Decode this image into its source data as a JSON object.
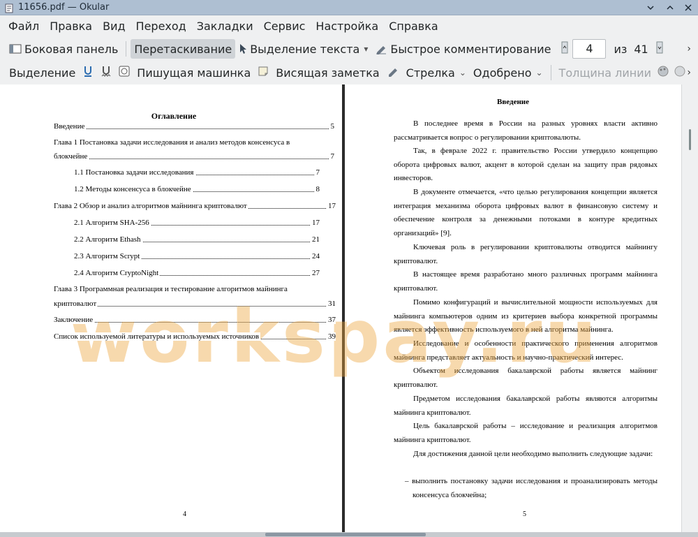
{
  "window": {
    "title": "11656.pdf  — Okular"
  },
  "menubar": [
    "Файл",
    "Правка",
    "Вид",
    "Переход",
    "Закладки",
    "Сервис",
    "Настройка",
    "Справка"
  ],
  "toolbar1": {
    "sidebar": "Боковая панель",
    "drag": "Перетаскивание",
    "select_text": "Выделение текста",
    "quick_comment": "Быстрое комментирование",
    "page_current": "4",
    "page_of": "из",
    "page_total": "41"
  },
  "toolbar2": {
    "selection": "Выделение",
    "typewriter": "Пишущая машинка",
    "sticky_note": "Висящая заметка",
    "arrow": "Стрелка",
    "approved": "Одобрено",
    "line_width": "Толщина линии"
  },
  "left_page": {
    "title": "Оглавление",
    "entries": [
      {
        "text": "Введение",
        "page": "5"
      },
      {
        "text": "Глава 1 Постановка задачи исследования и анализ методов консенсуса в",
        "page": ""
      },
      {
        "text": "блокчейне",
        "page": "7"
      },
      {
        "text": "1.1 Постановка задачи исследования",
        "page": "7"
      },
      {
        "text": "1.2 Методы консенсуса в блокчейне",
        "page": "8"
      },
      {
        "text": "Глава 2 Обзор и анализ алгоритмов майнинга криптовалют",
        "page": "17"
      },
      {
        "text": "2.1 Алгоритм SHA-256",
        "page": "17"
      },
      {
        "text": "2.2 Алгоритм Ethash",
        "page": "21"
      },
      {
        "text": "2.3 Алгоритм Scrypt",
        "page": "24"
      },
      {
        "text": "2.4 Алгоритм CryptoNight",
        "page": "27"
      },
      {
        "text": "Глава 3 Программная реализация и тестирование алгоритмов майнинга",
        "page": ""
      },
      {
        "text": "криптовалют",
        "page": "31"
      },
      {
        "text": "Заключение",
        "page": "37"
      },
      {
        "text": "Список используемой литературы и используемых источников",
        "page": "39"
      }
    ],
    "page_number": "4"
  },
  "right_page": {
    "title": "Введение",
    "paragraphs": [
      "В последнее время в России на разных уровнях власти активно рассматривается вопрос о регулировании криптовалюты.",
      "Так, в феврале 2022 г. правительство России утвердило концепцию оборота цифровых валют, акцент в которой сделан на защиту прав рядовых инвесторов.",
      "В документе отмечается, «что целью регулирования концепции является интеграция механизма оборота цифровых валют в финансовую систему и обеспечение контроля за денежными потоками в контуре кредитных организаций» [9].",
      "Ключевая роль в регулировании криптовалюты отводится майнингу криптовалют.",
      "В настоящее время разработано много различных программ майнинга криптовалют.",
      "Помимо конфигураций и вычислительной мощности используемых для майнинга компьютеров одним из критериев выбора конкретной программы является эффективность используемого в ней алгоритма майнинга.",
      "Исследование и особенности практического применения алгоритмов майнинга представляет актуальность и научно-практический интерес.",
      "Объектом исследования бакалаврской работы является майнинг криптовалют.",
      "Предметом исследования бакалаврской работы являются алгоритмы майнинга криптовалют.",
      "Цель бакалаврской работы – исследование и реализация алгоритмов майнинга криптовалют.",
      "Для достижения данной цели необходимо выполнить следующие задачи:",
      "– выполнить постановку задачи исследования и проанализировать методы консенсуса блокчейна;"
    ],
    "page_number": "5"
  },
  "watermark": "workspay.ru"
}
